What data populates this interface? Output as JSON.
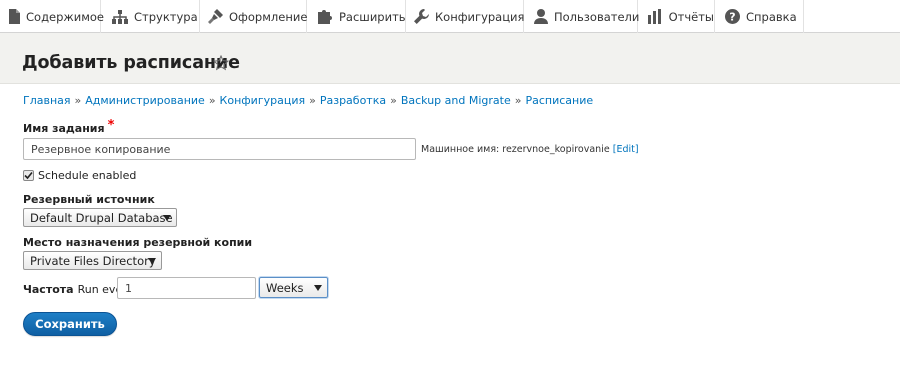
{
  "toolbar": {
    "items": [
      {
        "label": "Содержимое",
        "icon": "document-icon"
      },
      {
        "label": "Структура",
        "icon": "sitemap-icon"
      },
      {
        "label": "Оформление",
        "icon": "paint-brush-icon"
      },
      {
        "label": "Расширить",
        "icon": "puzzle-icon"
      },
      {
        "label": "Конфигурация",
        "icon": "wrench-icon"
      },
      {
        "label": "Пользователи",
        "icon": "user-icon"
      },
      {
        "label": "Отчёты",
        "icon": "bar-chart-icon"
      },
      {
        "label": "Справка",
        "icon": "help-icon"
      }
    ]
  },
  "page": {
    "title": "Добавить расписание"
  },
  "breadcrumb": [
    "Главная",
    "Администрирование",
    "Конфигурация",
    "Разработка",
    "Backup and Migrate",
    "Расписание"
  ],
  "breadcrumb_separator": "»",
  "form": {
    "task_name": {
      "label": "Имя задания",
      "required_mark": "*",
      "value": "Резервное копирование"
    },
    "machine_name": {
      "prefix": "Машинное имя: rezervnoe_kopirovanie",
      "edit_link": "[Edit]"
    },
    "schedule_enabled": {
      "label": "Schedule enabled",
      "checked": true
    },
    "backup_source": {
      "label": "Резервный источник",
      "selected": "Default Drupal Database"
    },
    "destination": {
      "label": "Место назначения резервной копии",
      "selected": "Private Files Directory"
    },
    "frequency": {
      "label": "Частота",
      "run_every_label": "Run every",
      "value": "1",
      "unit": "Weeks"
    },
    "save_label": "Сохранить"
  },
  "colors": {
    "link": "#0074bd",
    "primary_button": "#1a73bb",
    "header_band": "#f2f2ef",
    "required": "#e00000"
  }
}
